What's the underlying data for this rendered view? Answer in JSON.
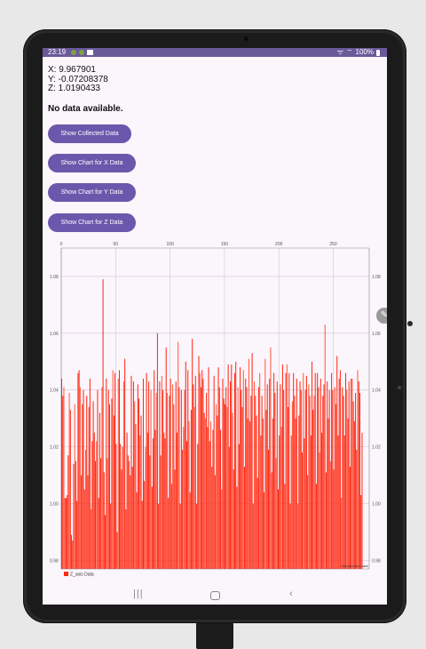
{
  "status_bar": {
    "time": "23:19",
    "battery": "100%"
  },
  "readout": {
    "x": "X: 9.967901",
    "y": "Y: -0.07208378",
    "z": "Z: 1.0190433"
  },
  "message": "No data available.",
  "buttons": {
    "show_collected": "Show Collected Data",
    "chart_x": "Show Chart for X Data",
    "chart_y": "Show Chart for Y Data",
    "chart_z": "Show Chart for Z Data"
  },
  "chart_data": {
    "type": "bar",
    "legend": "Z_axis Data",
    "description": "Description Label",
    "bar_color": "#ff2a14",
    "top_ticks": [
      "0",
      "50",
      "100",
      "150",
      "200",
      "250"
    ],
    "y_ticks": [
      "0.98",
      "1.00",
      "1.02",
      "1.04",
      "1.06",
      "1.08"
    ],
    "xlim": [
      0,
      283
    ],
    "ylim": [
      0.977,
      1.09
    ],
    "values": [
      1.044,
      1.038,
      1.041,
      1.002,
      1.002,
      1.003,
      1.017,
      1.039,
      1.033,
      0.989,
      0.987,
      1.014,
      1.035,
      1.015,
      1.001,
      1.046,
      1.047,
      1.041,
      1.01,
      1.035,
      1.04,
      1.005,
      1.019,
      1.038,
      1.01,
      1.034,
      1.044,
      0.998,
      1.022,
      1.036,
      1.025,
      1.015,
      1.022,
      1.04,
      1.002,
      1.032,
      1.016,
      1.041,
      1.079,
      1.011,
      0.996,
      1.044,
      1.016,
      1.04,
      1.035,
      1.0,
      1.037,
      1.047,
      1.031,
      1.046,
      1.021,
      0.99,
      1.044,
      1.047,
      1.021,
      1.012,
      1.02,
      1.043,
      1.051,
      0.998,
      1.025,
      1.017,
      1.015,
      1.01,
      1.045,
      1.013,
      1.043,
      1.036,
      1.028,
      1.004,
      1.042,
      1.037,
      1.024,
      1.031,
      1.001,
      1.044,
      1.008,
      1.02,
      1.046,
      1.025,
      1.043,
      1.017,
      1.04,
      1.006,
      1.023,
      1.047,
      1.026,
      1.039,
      1.06,
      1.0,
      1.043,
      1.017,
      1.045,
      1.04,
      1.025,
      1.023,
      1.055,
      1.039,
      1.002,
      1.038,
      1.044,
      1.007,
      1.042,
      1.035,
      1.012,
      1.043,
      1.025,
      1.057,
      1.041,
      1.0,
      1.04,
      1.019,
      1.027,
      1.04,
      1.05,
      1.022,
      1.047,
      1.029,
      1.004,
      1.033,
      1.058,
      1.042,
      1.034,
      1.045,
      1.0,
      1.021,
      1.052,
      1.046,
      1.041,
      1.047,
      1.044,
      1.032,
      1.03,
      1.039,
      1.027,
      1.048,
      1.022,
      1.029,
      1.013,
      1.026,
      1.045,
      1.01,
      1.035,
      1.031,
      1.048,
      1.041,
      1.026,
      1.005,
      1.044,
      1.037,
      1.035,
      1.041,
      1.034,
      1.049,
      1.02,
      1.043,
      1.049,
      1.032,
      1.012,
      1.046,
      1.05,
      1.006,
      1.041,
      1.021,
      1.048,
      1.04,
      1.034,
      1.047,
      1.013,
      1.044,
      1.041,
      1.03,
      1.051,
      1.029,
      1.038,
      1.053,
      1.0,
      1.043,
      1.038,
      1.031,
      1.009,
      1.041,
      1.046,
      1.024,
      1.038,
      1.03,
      1.004,
      1.051,
      1.033,
      1.042,
      1.019,
      1.044,
      1.055,
      1.011,
      1.03,
      1.046,
      1.039,
      1.016,
      1.043,
      1.005,
      1.024,
      1.042,
      1.027,
      1.049,
      1.04,
      1.007,
      1.046,
      1.049,
      1.034,
      1.046,
      1.0,
      1.024,
      1.036,
      1.046,
      1.038,
      1.03,
      1.044,
      1.0,
      1.031,
      1.043,
      1.04,
      1.018,
      1.046,
      1.023,
      1.04,
      1.045,
      1.01,
      1.042,
      1.038,
      1.024,
      1.05,
      1.033,
      1.038,
      1.046,
      1.007,
      1.046,
      1.041,
      1.018,
      1.044,
      1.025,
      1.038,
      1.042,
      1.063,
      1.011,
      1.043,
      1.03,
      1.04,
      1.015,
      1.046,
      1.04,
      1.012,
      1.041,
      1.035,
      1.052,
      1.024,
      1.044,
      1.047,
      1.002,
      1.041,
      1.038,
      1.024,
      1.046,
      1.04,
      1.03,
      1.043,
      1.013,
      1.044,
      1.044,
      1.036,
      1.029,
      1.039,
      1.019,
      1.047,
      1.043,
      1.039,
      1.003,
      1.025
    ]
  }
}
